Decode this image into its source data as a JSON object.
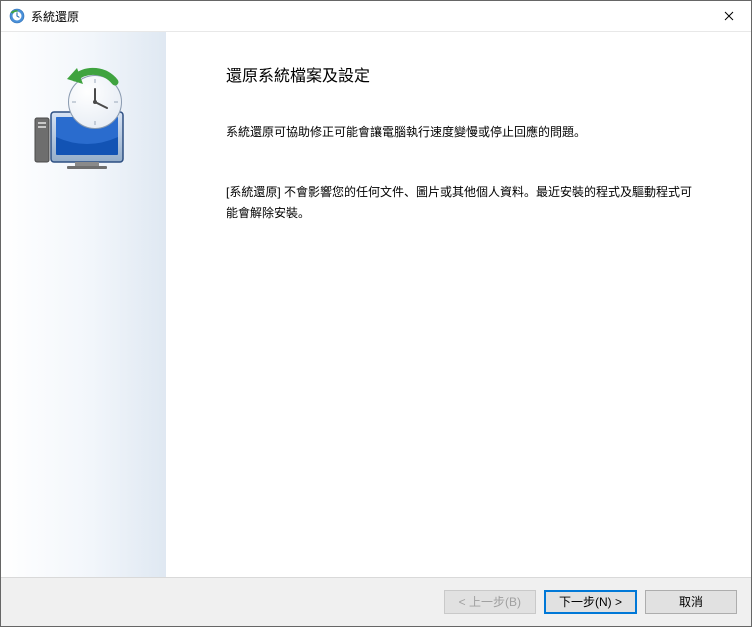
{
  "window": {
    "title": "系統還原"
  },
  "content": {
    "heading": "還原系統檔案及設定",
    "paragraph1": "系統還原可協助修正可能會讓電腦執行速度變慢或停止回應的問題。",
    "paragraph2": "[系統還原] 不會影響您的任何文件、圖片或其他個人資料。最近安裝的程式及驅動程式可能會解除安裝。"
  },
  "buttons": {
    "back": "< 上一步(B)",
    "next": "下一步(N) >",
    "cancel": "取消"
  },
  "icons": {
    "app": "system-restore-icon",
    "close": "close-icon",
    "graphic": "system-restore-graphic"
  }
}
